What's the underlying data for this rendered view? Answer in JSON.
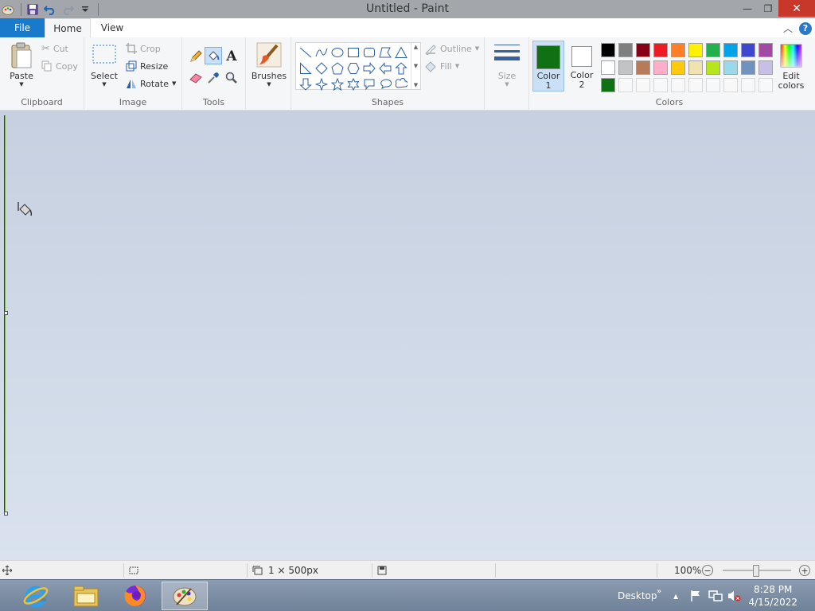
{
  "window": {
    "title": "Untitled - Paint",
    "minimize_glyph": "—",
    "restore_glyph": "❐",
    "close_glyph": "✕"
  },
  "tabs": [
    {
      "label": "File"
    },
    {
      "label": "Home"
    },
    {
      "label": "View"
    }
  ],
  "ribbon": {
    "clipboard": {
      "label": "Clipboard",
      "paste": "Paste",
      "cut": "Cut",
      "copy": "Copy"
    },
    "image": {
      "label": "Image",
      "select": "Select",
      "crop": "Crop",
      "resize": "Resize",
      "rotate": "Rotate"
    },
    "tools": {
      "label": "Tools"
    },
    "brushes": {
      "label": "Brushes"
    },
    "shapes": {
      "label": "Shapes",
      "outline": "Outline",
      "fill": "Fill"
    },
    "size": {
      "label": "Size"
    },
    "colors": {
      "label": "Colors",
      "color1_line1": "Color",
      "color1_line2": "1",
      "color2_line1": "Color",
      "color2_line2": "2",
      "edit_line1": "Edit",
      "edit_line2": "colors",
      "color1_value": "#0f7113",
      "color2_value": "#ffffff",
      "palette": [
        "#000000",
        "#7f7f7f",
        "#880015",
        "#ed1c24",
        "#ff7f27",
        "#fff200",
        "#22b14c",
        "#00a2e8",
        "#3f48cc",
        "#a349a4",
        "#ffffff",
        "#c3c3c3",
        "#b97a57",
        "#ffaec9",
        "#ffc90e",
        "#efe4b0",
        "#b5e61d",
        "#99d9ea",
        "#7092be",
        "#c8bfe7",
        "#0f7113",
        "",
        "",
        "",
        "",
        "",
        "",
        "",
        "",
        ""
      ]
    }
  },
  "statusbar": {
    "dimensions": "1 × 500px",
    "zoom": "100%"
  },
  "taskbar": {
    "desktop_label": "Desktop",
    "time": "8:28 PM",
    "date": "4/15/2022"
  }
}
